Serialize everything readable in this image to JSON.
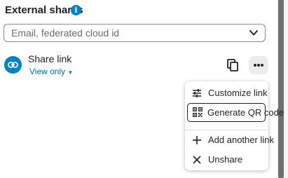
{
  "section": {
    "title": "External shares",
    "info_icon": "info-icon"
  },
  "search": {
    "placeholder": "Email, federated cloud id"
  },
  "share": {
    "label": "Share link",
    "permission": "View only",
    "permission_caret": "▾"
  },
  "menu": {
    "items": [
      {
        "label": "Customize link",
        "icon": "tune-icon"
      },
      {
        "label": "Generate QR code",
        "icon": "qr-code-icon"
      },
      {
        "label": "Add another link",
        "icon": "plus-icon"
      },
      {
        "label": "Unshare",
        "icon": "close-icon"
      }
    ]
  },
  "colors": {
    "accent": "#0082c9",
    "link": "#0073b5"
  }
}
